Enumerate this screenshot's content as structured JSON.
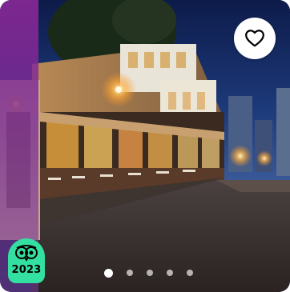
{
  "photo": {
    "subject": "street-scene-photo"
  },
  "favorite": {
    "icon": "heart-outline-icon"
  },
  "award": {
    "icon": "owl-icon",
    "year": "2023",
    "color": "#34e0a1"
  },
  "carousel": {
    "dots": 5,
    "active_index": 0
  }
}
